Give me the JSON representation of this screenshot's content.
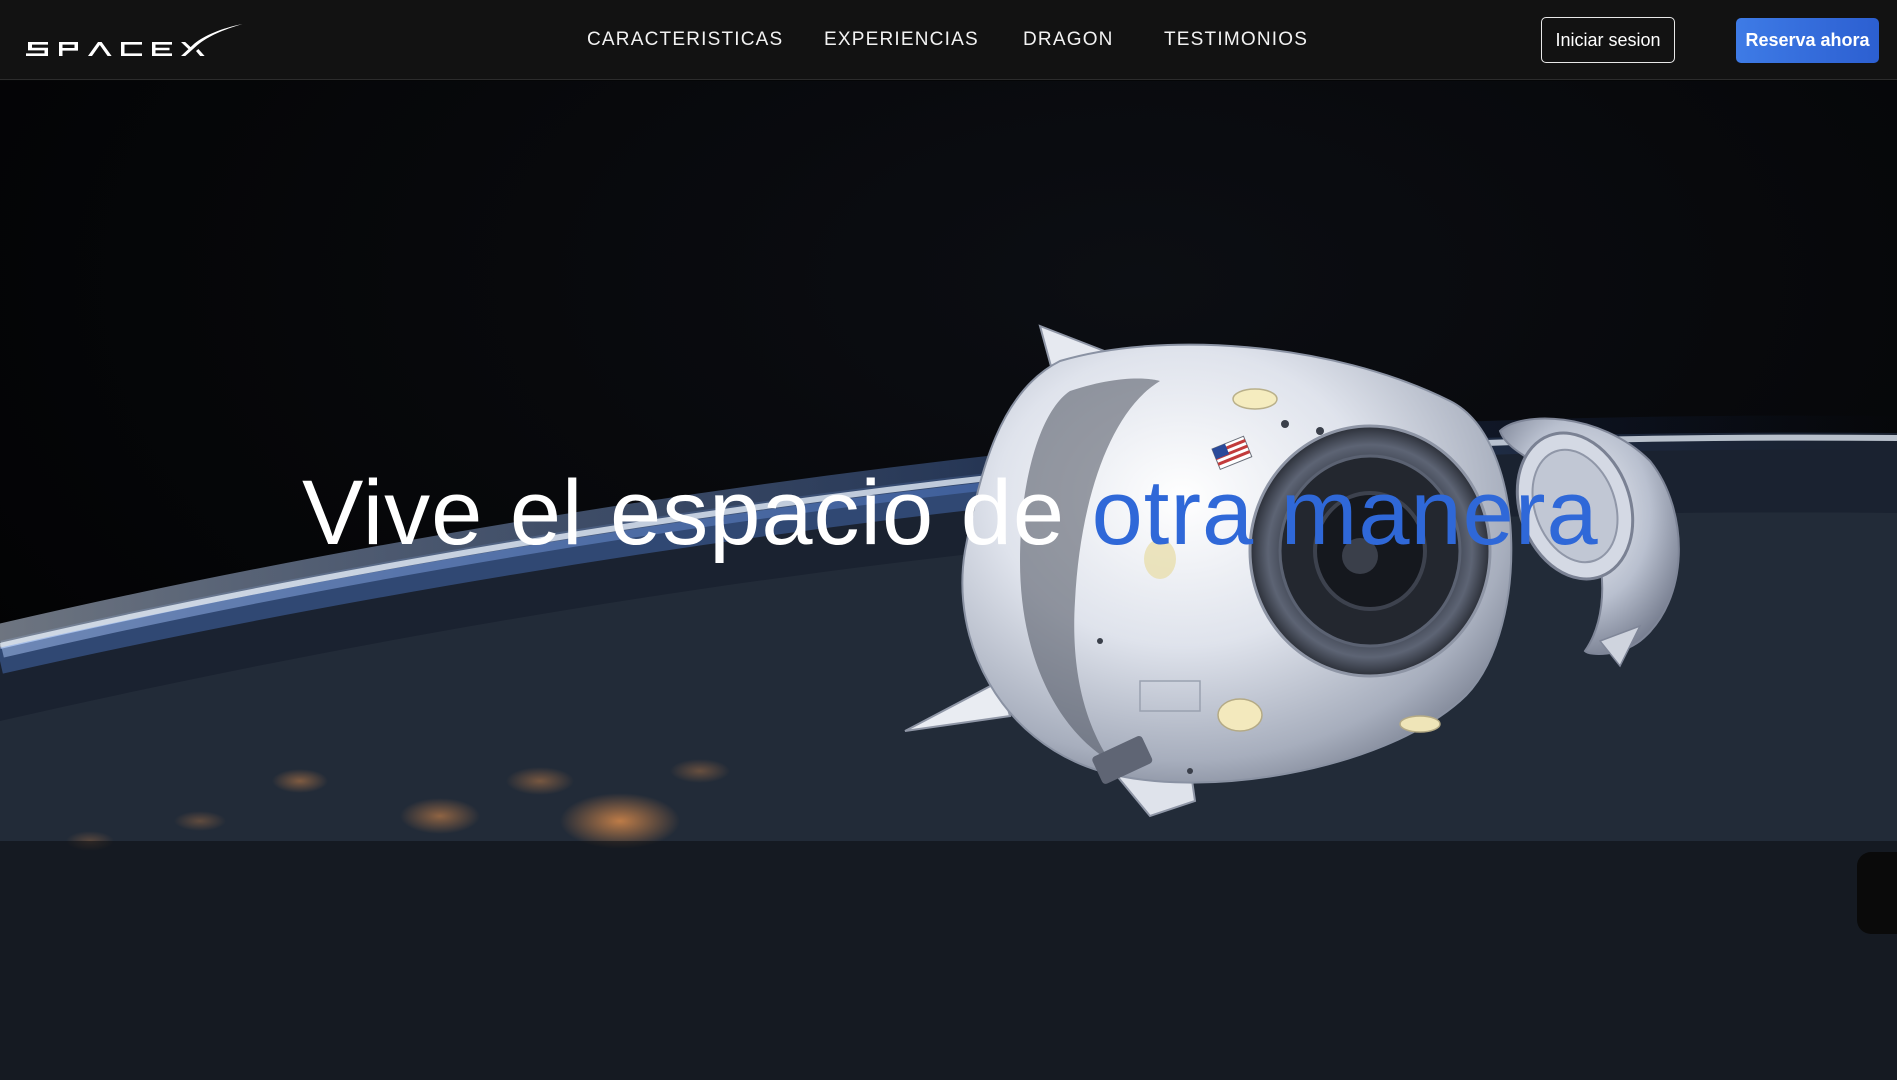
{
  "brand": {
    "logo_text": "SPACEX",
    "logo_icon": "spacex-logo"
  },
  "nav": {
    "links": [
      {
        "label": "CARACTERISTICAS"
      },
      {
        "label": "EXPERIENCIAS"
      },
      {
        "label": "DRAGON"
      },
      {
        "label": "TESTIMONIOS"
      }
    ],
    "login_label": "Iniciar sesion",
    "book_label": "Reserva ahora"
  },
  "hero": {
    "headline_main": "Vive el espacio de ",
    "headline_accent": "otra manera",
    "image": "dragon-capsule-over-earth"
  },
  "colors": {
    "nav_background": "#121212",
    "accent": "#2f68d8",
    "book_button": "#3e7be6",
    "text": "#ffffff"
  }
}
